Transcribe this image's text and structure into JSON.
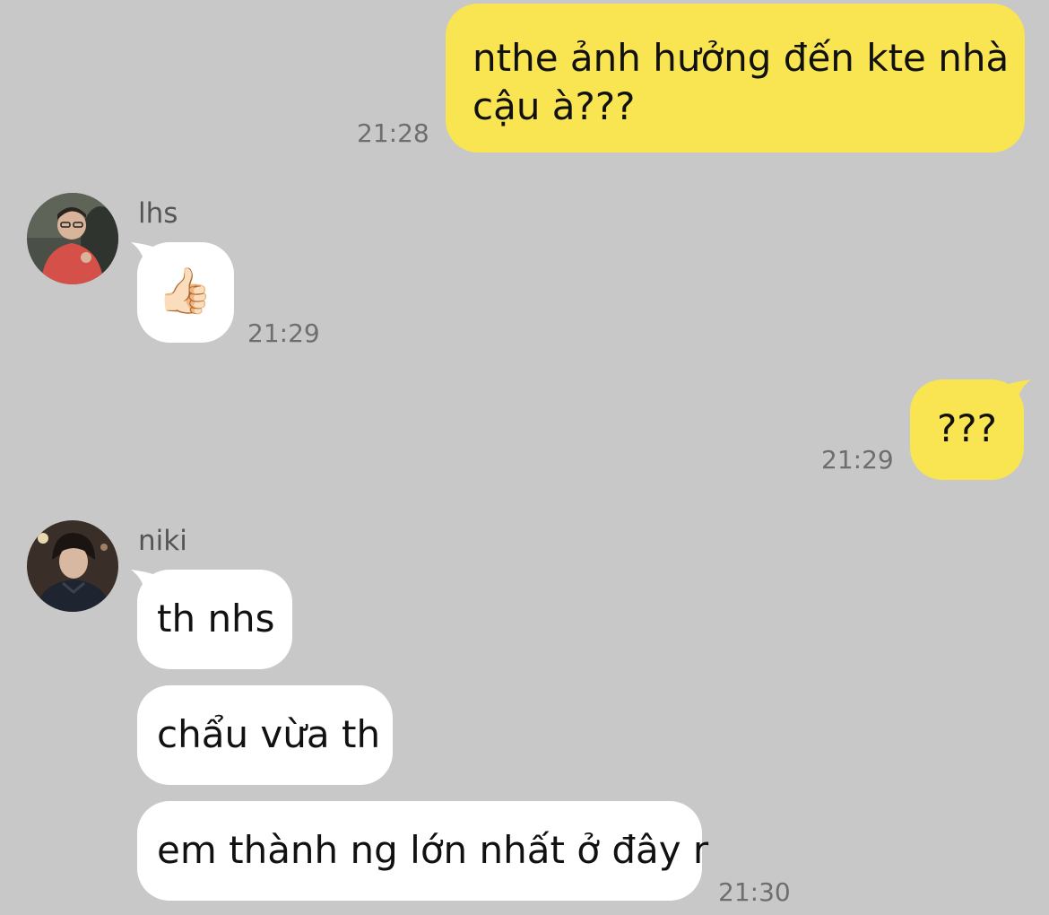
{
  "messages": [
    {
      "from": "me",
      "text_line1": "nthe ảnh hưởng đến kte nhà",
      "text_line2": "cậu à???",
      "time": "21:28"
    },
    {
      "from": "lhs",
      "sender": "lhs",
      "emoji": "👍🏻",
      "emoji_name": "thumbs-up",
      "time": "21:29"
    },
    {
      "from": "me",
      "text": "???",
      "time": "21:29"
    },
    {
      "from": "niki",
      "sender": "niki",
      "lines": [
        "th nhs",
        "chẩu vừa th",
        "em thành ng lớn nhất ở đây r"
      ],
      "time": "21:30"
    }
  ],
  "colors": {
    "background": "#c8c8c8",
    "my_bubble": "#f9e452",
    "their_bubble": "#ffffff",
    "timestamp": "#6e6e6e"
  }
}
